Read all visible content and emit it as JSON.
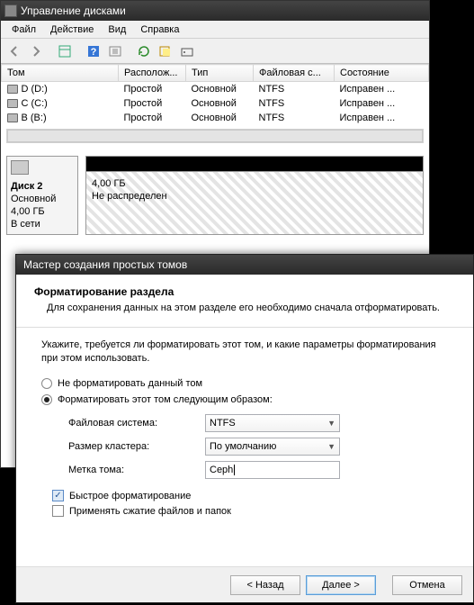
{
  "dm": {
    "title": "Управление дисками",
    "menu": {
      "file": "Файл",
      "action": "Действие",
      "view": "Вид",
      "help": "Справка"
    },
    "columns": {
      "vol": "Том",
      "layout": "Располож...",
      "type": "Тип",
      "fs": "Файловая с...",
      "status": "Состояние"
    },
    "rows": [
      {
        "vol": "D (D:)",
        "layout": "Простой",
        "type": "Основной",
        "fs": "NTFS",
        "status": "Исправен ..."
      },
      {
        "vol": "C (C:)",
        "layout": "Простой",
        "type": "Основной",
        "fs": "NTFS",
        "status": "Исправен ..."
      },
      {
        "vol": "B (B:)",
        "layout": "Простой",
        "type": "Основной",
        "fs": "NTFS",
        "status": "Исправен ..."
      }
    ],
    "disk": {
      "name": "Диск 2",
      "type": "Основной",
      "size": "4,00 ГБ",
      "online": "В сети",
      "part_size": "4,00 ГБ",
      "part_status": "Не распределен"
    }
  },
  "wizard": {
    "title": "Мастер создания простых томов",
    "header_title": "Форматирование раздела",
    "header_desc": "Для сохранения данных на этом разделе его необходимо сначала отформатировать.",
    "intro": "Укажите, требуется ли форматировать этот том, и какие параметры форматирования при этом использовать.",
    "radio_no": "Не форматировать данный том",
    "radio_yes": "Форматировать этот том следующим образом:",
    "labels": {
      "fs": "Файловая система:",
      "cluster": "Размер кластера:",
      "label": "Метка тома:"
    },
    "values": {
      "fs": "NTFS",
      "cluster": "По умолчанию",
      "label": "Ceph"
    },
    "quick": "Быстрое форматирование",
    "compress": "Применять сжатие файлов и папок",
    "buttons": {
      "back": "< Назад",
      "next": "Далее >",
      "cancel": "Отмена"
    }
  }
}
